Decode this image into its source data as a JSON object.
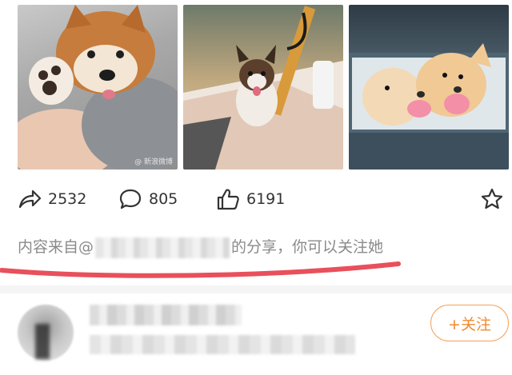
{
  "photos": {
    "items": [
      {
        "alt": "shiba-puppy-photo",
        "watermark": "@ 新浪微博"
      },
      {
        "alt": "corgi-puppy-photo",
        "watermark": ""
      },
      {
        "alt": "golden-retriever-puppies-photo",
        "watermark": ""
      }
    ]
  },
  "actions": {
    "share_count": "2532",
    "comment_count": "805",
    "like_count": "6191",
    "share_icon": "share-icon",
    "comment_icon": "comment-icon",
    "like_icon": "thumbs-up-icon",
    "fav_icon": "star-icon"
  },
  "source": {
    "prefix": "内容来自@",
    "suffix": "的分享，你可以关注她"
  },
  "author": {
    "follow_label": "+关注"
  },
  "colors": {
    "accent": "#f08a2e",
    "highlight_underline": "#e8505b",
    "text_gray": "#8a8a8a"
  }
}
